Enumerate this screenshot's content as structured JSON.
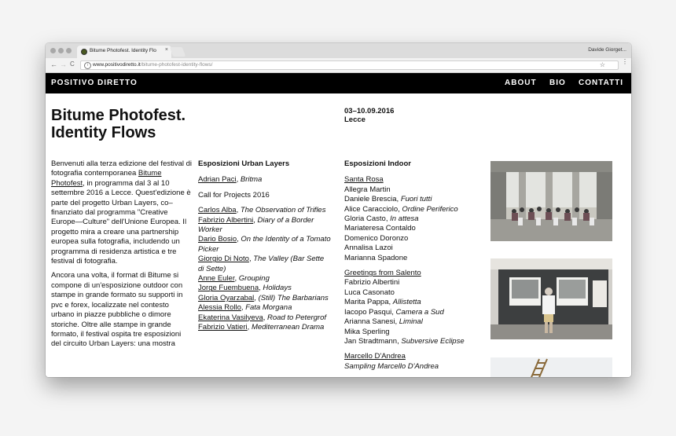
{
  "browser": {
    "tab_title": "Bitume Photofest. Identity Flo",
    "tab_close": "×",
    "profile_name": "Davide Giorget...",
    "url_host": "www.positivodiretto.it",
    "url_path": "/bitume-photofest-identity-flows/",
    "back": "←",
    "forward": "→",
    "reload": "C",
    "info": "i",
    "star": "☆",
    "menu": "⋮"
  },
  "site": {
    "brand": "POSITIVO DIRETTO",
    "nav": [
      "ABOUT",
      "BIO",
      "CONTATTI"
    ]
  },
  "page": {
    "title": "Bitume Photofest. Identity Flows",
    "date": "03–10.09.2016",
    "place": "Lecce",
    "intro1": {
      "before": "Benvenuti alla terza edizione del festival di fotografia contemporanea ",
      "link": "Bitume Photofest",
      "after": ", in programma dal 3 al 10 settembre 2016 a Lecce. Quest'edizione è parte del progetto Urban Layers, co–finanziato dal programma \"Creative Europe—Culture\" dell'Unione Europea. Il progetto mira a creare una partnership europea sulla fotografia, includendo un programma di residenza artistica e tre festival di fotografia."
    },
    "intro2": "Ancora una volta, il format di Bitume si compone di un'esposizione outdoor con stampe in grande formato su supporti in pvc e forex, localizzate nel contesto urbano in piazze pubbliche o dimore storiche. Oltre alle stampe in grande formato, il festival ospita tre esposizioni del circuito Urban Layers: una mostra",
    "urban_layers": {
      "heading": "Esposizioni Urban Layers",
      "first": {
        "name": "Adrian Paci",
        "work": "Britma"
      },
      "call": "Call for Projects 2016",
      "artists": [
        {
          "name": "Carlos Alba",
          "work": "The Observation of Trifles"
        },
        {
          "name": "Fabrizio Albertini",
          "work": "Diary of a Border Worker"
        },
        {
          "name": "Dario Bosio",
          "work": "On the Identity of a Tomato Picker"
        },
        {
          "name": "Giorgio Di Noto",
          "work": "The Valley (Bar Sette di Sette)"
        },
        {
          "name": "Anne Euler",
          "work": "Grouping"
        },
        {
          "name": "Jorge Fuembuena",
          "work": "Holidays"
        },
        {
          "name": "Gloria Oyarzabal",
          "work": "(Still) The Barbarians"
        },
        {
          "name": "Alessia Rollo",
          "work": "Fata Morgana"
        },
        {
          "name": "Ekaterina Vasilyeva",
          "work": "Road to Petergrof"
        },
        {
          "name": "Fabrizio Vatieri",
          "work": "Mediterranean Drama"
        }
      ]
    },
    "indoor": {
      "heading": "Esposizioni Indoor",
      "groups": [
        {
          "title": "Santa Rosa",
          "entries": [
            {
              "name": "Allegra Martin",
              "work": ""
            },
            {
              "name": "Daniele Brescia",
              "work": "Fuori tutti"
            },
            {
              "name": "Alice Caracciolo",
              "work": "Ordine Periferico"
            },
            {
              "name": "Gloria Casto",
              "work": "In attesa"
            },
            {
              "name": "Mariateresa Contaldo",
              "work": ""
            },
            {
              "name": "Domenico Doronzo",
              "work": ""
            },
            {
              "name": "Annalisa Lazoi",
              "work": ""
            },
            {
              "name": "Marianna Spadone",
              "work": ""
            }
          ]
        },
        {
          "title": "Greetings from Salento",
          "entries": [
            {
              "name": "Fabrizio Albertini",
              "work": ""
            },
            {
              "name": "Luca Casonato",
              "work": ""
            },
            {
              "name": "Marita Pappa",
              "work": "Allistetta"
            },
            {
              "name": "Iacopo Pasqui",
              "work": "Camera a Sud"
            },
            {
              "name": "Arianna Sanesi",
              "work": "Liminal"
            },
            {
              "name": "Mika Sperling",
              "work": ""
            },
            {
              "name": "Jan Stradtmann",
              "work": "Subversive Eclipse"
            }
          ]
        },
        {
          "title": "Marcello D'Andrea",
          "subtitle": "Sampling Marcello D'Andrea",
          "entries": []
        }
      ]
    }
  }
}
